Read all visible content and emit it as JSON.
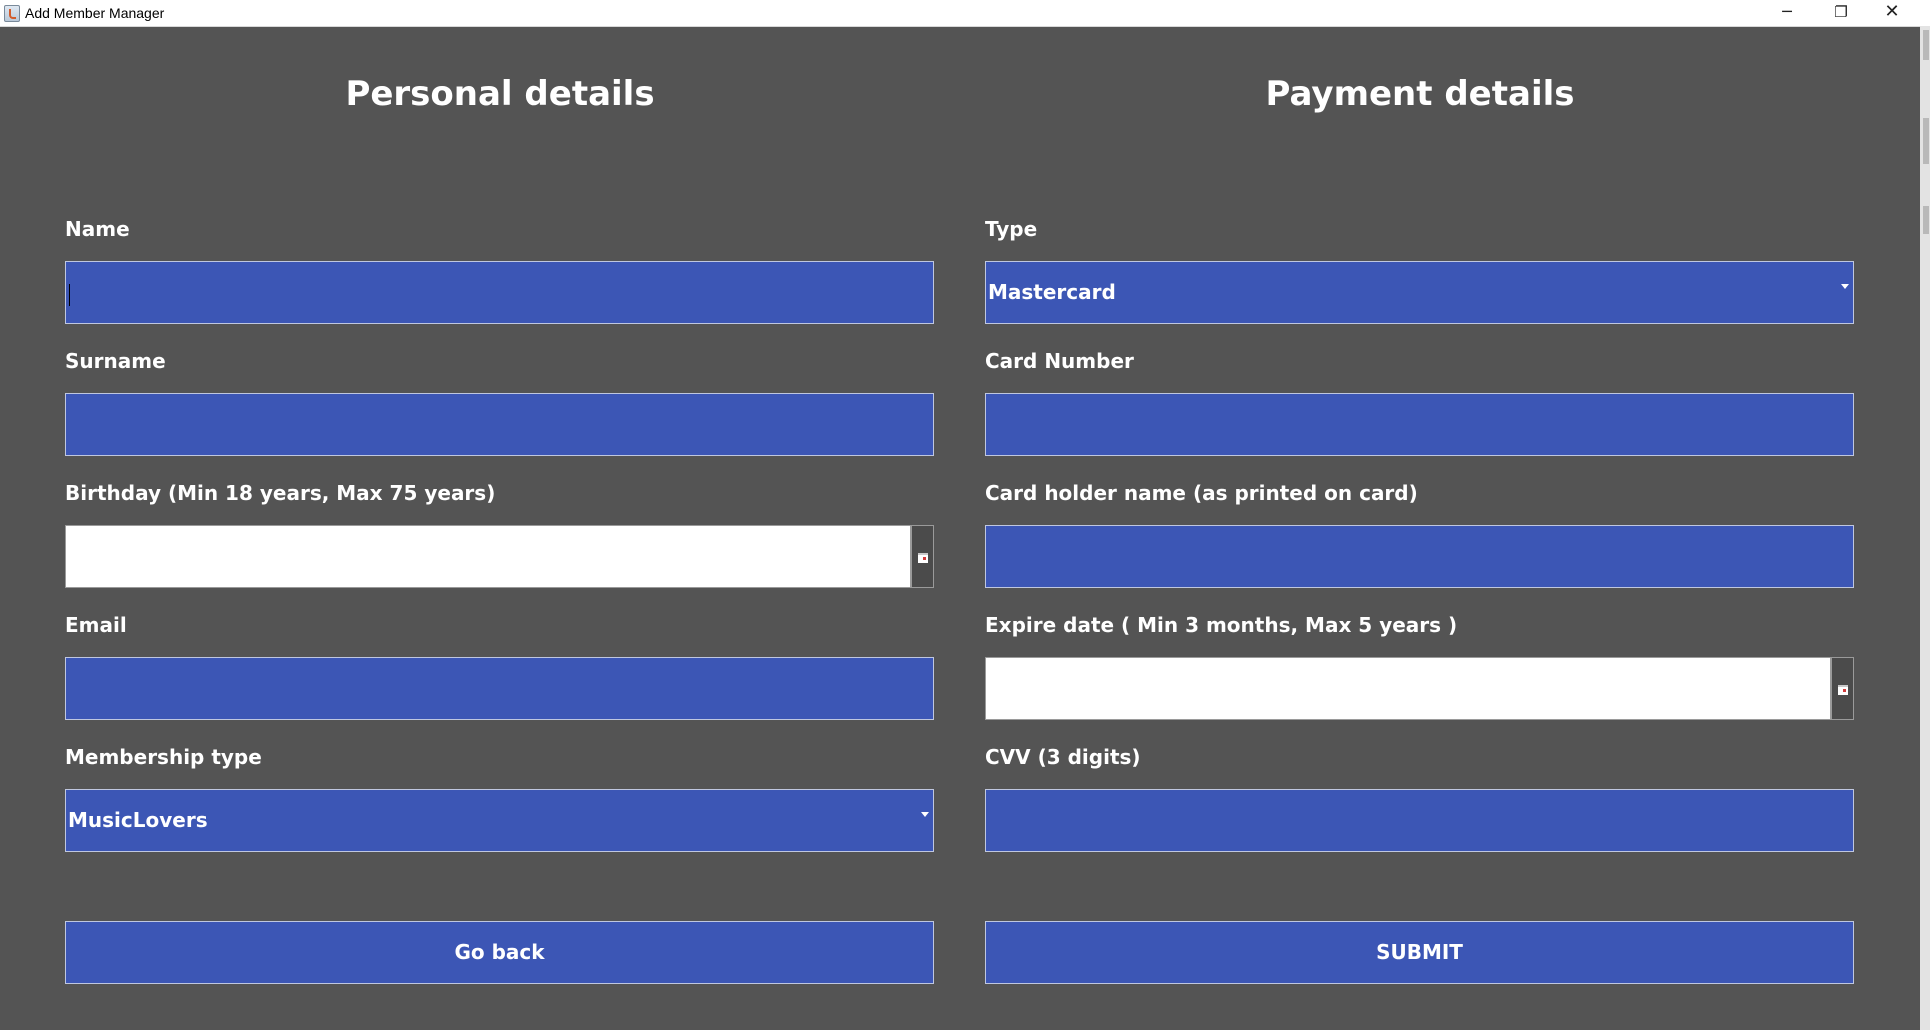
{
  "window": {
    "title": "Add Member Manager",
    "controls": {
      "minimize": "─",
      "maximize": "❐",
      "close": "✕"
    }
  },
  "personal": {
    "heading": "Personal details",
    "name_label": "Name",
    "name_value": "",
    "surname_label": "Surname",
    "surname_value": "",
    "birthday_label": "Birthday (Min 18 years, Max 75 years)",
    "birthday_value": "",
    "email_label": "Email",
    "email_value": "",
    "membership_label": "Membership type",
    "membership_value": "MusicLovers"
  },
  "payment": {
    "heading": "Payment details",
    "type_label": "Type",
    "type_value": "Mastercard",
    "card_number_label": "Card Number",
    "card_number_value": "",
    "holder_label": "Card holder name (as printed on card)",
    "holder_value": "",
    "expire_label": "Expire date ( Min 3 months, Max 5 years )",
    "expire_value": "",
    "cvv_label": "CVV (3 digits)",
    "cvv_value": ""
  },
  "actions": {
    "go_back": "Go back",
    "submit": "SUBMIT"
  },
  "colors": {
    "background": "#545454",
    "field": "#3c56b5",
    "text": "#ffffff"
  },
  "icons": [
    "app-icon",
    "calendar-icon",
    "chevron-down-icon",
    "minimize-icon",
    "maximize-icon",
    "close-icon"
  ]
}
